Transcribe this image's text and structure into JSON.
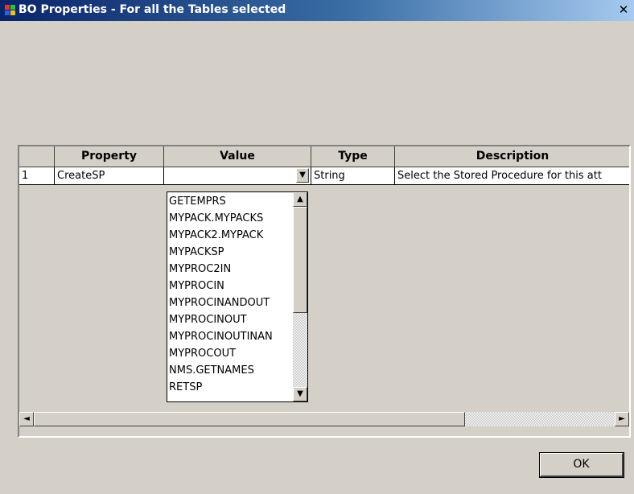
{
  "window": {
    "title": "BO Properties - For all the Tables selected",
    "close_glyph": "✕"
  },
  "colors": {
    "titlebar_start": "#0a246a",
    "titlebar_end": "#a6caf0",
    "face": "#d4d0c8"
  },
  "grid": {
    "columns": [
      "",
      "Property",
      "Value",
      "Type",
      "Description"
    ],
    "rows": [
      {
        "index": "1",
        "property": "CreateSP",
        "value": "",
        "type": "String",
        "description": "Select the Stored Procedure for this att"
      }
    ]
  },
  "dropdown": {
    "options": [
      "GETEMPRS",
      "MYPACK.MYPACKS",
      "MYPACK2.MYPACK",
      "MYPACKSP",
      "MYPROC2IN",
      "MYPROCIN",
      "MYPROCINANDOUT",
      "MYPROCINOUT",
      "MYPROCINOUTINAN",
      "MYPROCOUT",
      "NMS.GETNAMES",
      "RETSP"
    ]
  },
  "icons": {
    "dropdown_arrow": "▼",
    "scroll_up": "▲",
    "scroll_down": "▼",
    "scroll_left": "◄",
    "scroll_right": "►"
  },
  "buttons": {
    "ok_label": "OK"
  }
}
